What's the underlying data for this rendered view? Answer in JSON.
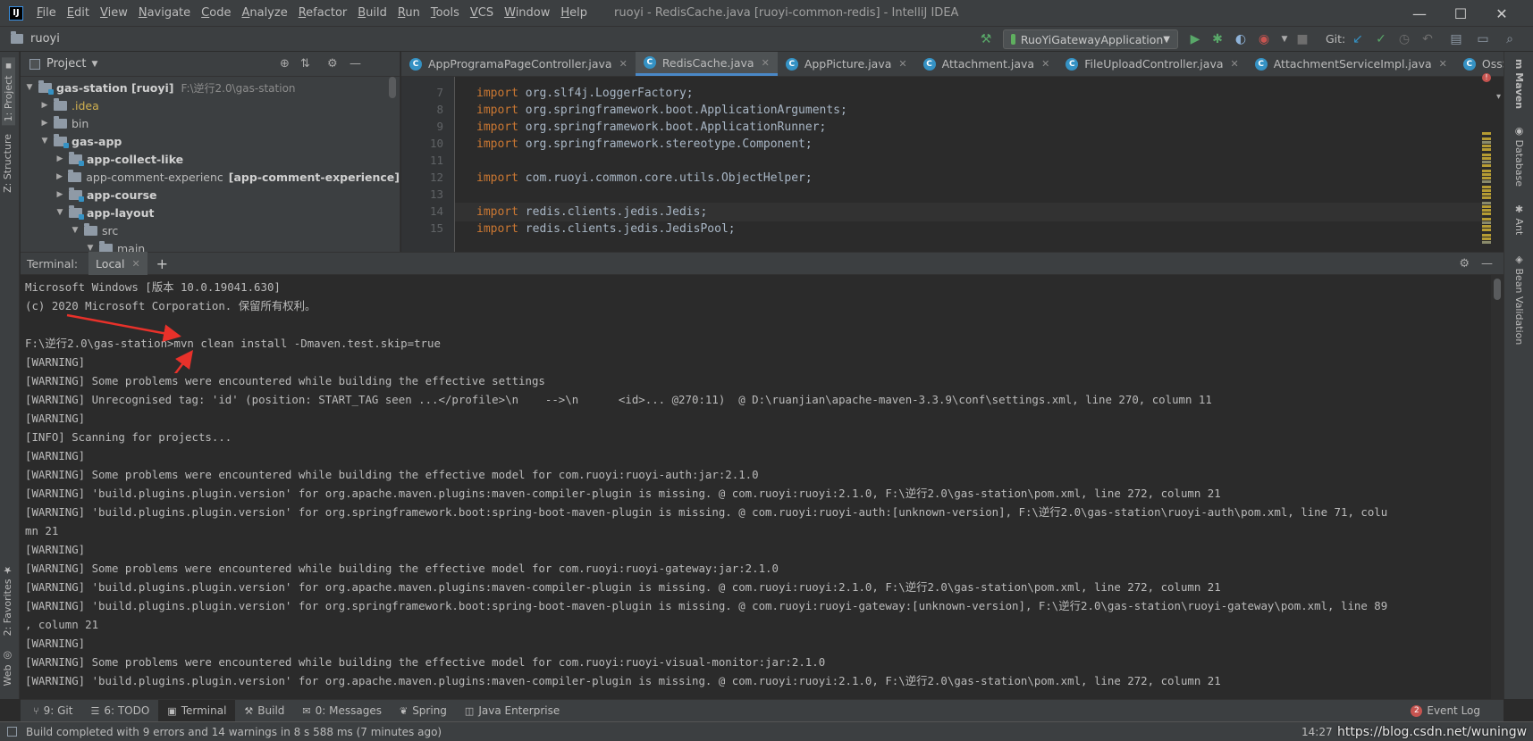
{
  "menu": {
    "logo": "IJ",
    "items": [
      "File",
      "Edit",
      "View",
      "Navigate",
      "Code",
      "Analyze",
      "Refactor",
      "Build",
      "Run",
      "Tools",
      "VCS",
      "Window",
      "Help"
    ],
    "title": "ruoyi - RedisCache.java [ruoyi-common-redis] - IntelliJ IDEA"
  },
  "navbar": {
    "project": "ruoyi",
    "run_config": "RuoYiGatewayApplication",
    "git_label": "Git:"
  },
  "left_stripe": {
    "project_tab": "1: Project",
    "structure_tab": "Z: Structure",
    "favorites_tab": "2: Favorites",
    "web_tab": "Web"
  },
  "right_stripe": {
    "maven": "Maven",
    "database": "Database",
    "ant": "Ant",
    "bean": "Bean Validation"
  },
  "project_panel": {
    "title": "Project",
    "tree": [
      {
        "label": "gas-station [ruoyi]",
        "suffix": "F:\\逆行2.0\\gas-station",
        "bold": true,
        "expanded": true,
        "indent": 0
      },
      {
        "label": ".idea",
        "bold": false,
        "expanded": false,
        "indent": 1,
        "color": "#d0b050"
      },
      {
        "label": "bin",
        "bold": false,
        "expanded": false,
        "indent": 1
      },
      {
        "label": "gas-app",
        "bold": true,
        "expanded": true,
        "indent": 1
      },
      {
        "label": "app-collect-like",
        "bold": true,
        "expanded": false,
        "indent": 2
      },
      {
        "label": "app-comment-experienc",
        "suffix": "[app-comment-experience]",
        "bold": false,
        "expanded": false,
        "indent": 2
      },
      {
        "label": "app-course",
        "bold": true,
        "expanded": false,
        "indent": 2
      },
      {
        "label": "app-layout",
        "bold": true,
        "expanded": true,
        "indent": 2
      },
      {
        "label": "src",
        "bold": false,
        "expanded": true,
        "indent": 3
      },
      {
        "label": "main",
        "bold": false,
        "expanded": true,
        "indent": 4
      }
    ]
  },
  "editor": {
    "tabs": [
      {
        "label": "AppProgramaPageController.java",
        "active": false
      },
      {
        "label": "RedisCache.java",
        "active": true
      },
      {
        "label": "AppPicture.java",
        "active": false
      },
      {
        "label": "Attachment.java",
        "active": false
      },
      {
        "label": "FileUploadController.java",
        "active": false
      },
      {
        "label": "AttachmentServiceImpl.java",
        "active": false
      },
      {
        "label": "OssServiceImpl.jav",
        "active": false
      }
    ],
    "lines": [
      {
        "no": "7",
        "kw": "import",
        "text": " org.slf4j.LoggerFactory;"
      },
      {
        "no": "8",
        "kw": "import",
        "text": " org.springframework.boot.ApplicationArguments;"
      },
      {
        "no": "9",
        "kw": "import",
        "text": " org.springframework.boot.ApplicationRunner;"
      },
      {
        "no": "10",
        "kw": "import",
        "text": " org.springframework.stereotype.Component;"
      },
      {
        "no": "11",
        "kw": "",
        "text": ""
      },
      {
        "no": "12",
        "kw": "import",
        "text": " com.ruoyi.common.core.utils.ObjectHelper;"
      },
      {
        "no": "13",
        "kw": "",
        "text": ""
      },
      {
        "no": "14",
        "kw": "import",
        "text": " redis.clients.jedis.Jedis;"
      },
      {
        "no": "15",
        "kw": "import",
        "text": " redis.clients.jedis.JedisPool;"
      }
    ]
  },
  "terminal": {
    "label": "Terminal:",
    "tab": "Local",
    "lines": [
      "Microsoft Windows [版本 10.0.19041.630]",
      "(c) 2020 Microsoft Corporation. 保留所有权利。",
      "",
      "F:\\逆行2.0\\gas-station>mvn clean install -Dmaven.test.skip=true",
      "[WARNING]",
      "[WARNING] Some problems were encountered while building the effective settings",
      "[WARNING] Unrecognised tag: 'id' (position: START_TAG seen ...</profile>\\n    -->\\n      <id>... @270:11)  @ D:\\ruanjian\\apache-maven-3.3.9\\conf\\settings.xml, line 270, column 11",
      "[WARNING]",
      "[INFO] Scanning for projects...",
      "[WARNING]",
      "[WARNING] Some problems were encountered while building the effective model for com.ruoyi:ruoyi-auth:jar:2.1.0",
      "[WARNING] 'build.plugins.plugin.version' for org.apache.maven.plugins:maven-compiler-plugin is missing. @ com.ruoyi:ruoyi:2.1.0, F:\\逆行2.0\\gas-station\\pom.xml, line 272, column 21",
      "[WARNING] 'build.plugins.plugin.version' for org.springframework.boot:spring-boot-maven-plugin is missing. @ com.ruoyi:ruoyi-auth:[unknown-version], F:\\逆行2.0\\gas-station\\ruoyi-auth\\pom.xml, line 71, colu",
      "mn 21",
      "[WARNING]",
      "[WARNING] Some problems were encountered while building the effective model for com.ruoyi:ruoyi-gateway:jar:2.1.0",
      "[WARNING] 'build.plugins.plugin.version' for org.apache.maven.plugins:maven-compiler-plugin is missing. @ com.ruoyi:ruoyi:2.1.0, F:\\逆行2.0\\gas-station\\pom.xml, line 272, column 21",
      "[WARNING] 'build.plugins.plugin.version' for org.springframework.boot:spring-boot-maven-plugin is missing. @ com.ruoyi:ruoyi-gateway:[unknown-version], F:\\逆行2.0\\gas-station\\ruoyi-gateway\\pom.xml, line 89",
      ", column 21",
      "[WARNING]",
      "[WARNING] Some problems were encountered while building the effective model for com.ruoyi:ruoyi-visual-monitor:jar:2.1.0",
      "[WARNING] 'build.plugins.plugin.version' for org.apache.maven.plugins:maven-compiler-plugin is missing. @ com.ruoyi:ruoyi:2.1.0, F:\\逆行2.0\\gas-station\\pom.xml, line 272, column 21"
    ]
  },
  "bottom_tabs": [
    {
      "icon": "git-icon",
      "glyph": "⑂",
      "label": "9: Git"
    },
    {
      "icon": "todo-icon",
      "glyph": "☰",
      "label": "6: TODO"
    },
    {
      "icon": "terminal-icon",
      "glyph": "▣",
      "label": "Terminal",
      "active": true
    },
    {
      "icon": "hammer-icon",
      "glyph": "⚒",
      "label": "Build"
    },
    {
      "icon": "messages-icon",
      "glyph": "✉",
      "label": "0: Messages"
    },
    {
      "icon": "spring-icon",
      "glyph": "❦",
      "label": "Spring"
    },
    {
      "icon": "java-ee-icon",
      "glyph": "◫",
      "label": "Java Enterprise"
    }
  ],
  "event_log": {
    "count": "2",
    "label": "Event Log"
  },
  "status": {
    "message": "Build completed with 9 errors and 14 warnings in 8 s 588 ms (7 minutes ago)",
    "time": "14:27",
    "watermark": "https://blog.csdn.net/wuningw"
  },
  "colors": {
    "accent": "#4a88c7",
    "annotation_arrow": "#e8312a",
    "keyword": "#cc7832"
  }
}
